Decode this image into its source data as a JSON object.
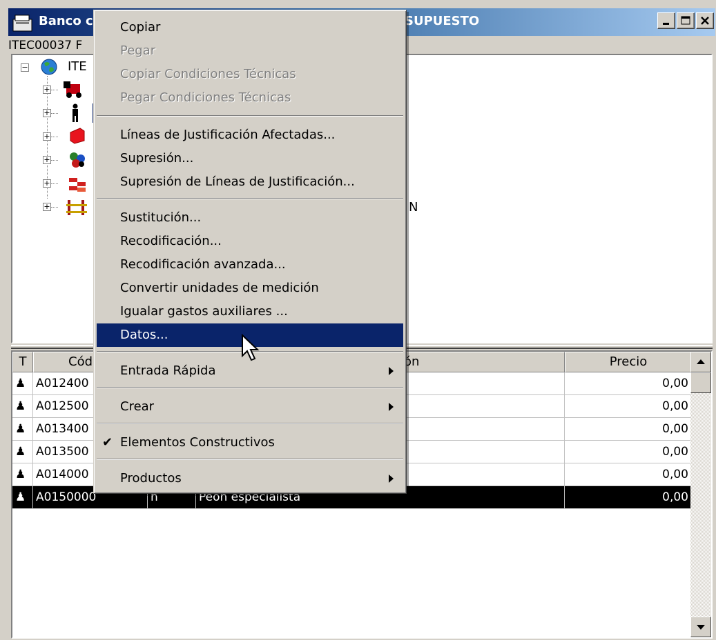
{
  "window": {
    "title_left": "Banco c",
    "title_right": "SUPUESTO",
    "path": "ITEC00037 F"
  },
  "tree": {
    "root_label": "ITE",
    "partial_text": "N",
    "nodes": [
      {
        "icon": "machinery-icon"
      },
      {
        "icon": "worker-icon"
      },
      {
        "icon": "material-icon"
      },
      {
        "icon": "components-icon"
      },
      {
        "icon": "bricks-icon"
      },
      {
        "icon": "scaffold-icon"
      }
    ]
  },
  "grid": {
    "headers": {
      "type": "T",
      "code": "Cód",
      "description": "ón",
      "price": "Precio"
    },
    "rows": [
      {
        "code": "A012400",
        "unit": "",
        "description": "",
        "price": "0,00"
      },
      {
        "code": "A012500",
        "unit": "",
        "description": "",
        "price": "0,00"
      },
      {
        "code": "A013400",
        "unit": "",
        "description": "",
        "price": "0,00"
      },
      {
        "code": "A013500",
        "unit": "",
        "description": "",
        "price": "0,00"
      },
      {
        "code": "A014000",
        "unit": "",
        "description": "",
        "price": "0,00"
      },
      {
        "code": "A0150000",
        "unit": "h",
        "description": "Peón especialista",
        "price": "0,00"
      }
    ]
  },
  "context_menu": {
    "copy": "Copiar",
    "paste": "Pegar",
    "copy_conditions": "Copiar Condiciones Técnicas",
    "paste_conditions": "Pegar Condiciones Técnicas",
    "affected_lines": "Líneas de Justificación Afectadas...",
    "delete": "Supresión...",
    "delete_lines": "Supresión de Líneas de Justificación...",
    "substitution": "Sustitución...",
    "recode": "Recodificación...",
    "advanced_recode": "Recodificación avanzada...",
    "convert_units": "Convertir unidades de medición",
    "equalize_costs": "Igualar gastos auxiliares ...",
    "data": "Datos...",
    "quick_entry": "Entrada Rápida",
    "create": "Crear",
    "constructive_elements": "Elementos Constructivos",
    "products": "Productos"
  },
  "colors": {
    "highlight": "#0a246a",
    "selected_row": "#000000",
    "face": "#d4d0c8"
  }
}
